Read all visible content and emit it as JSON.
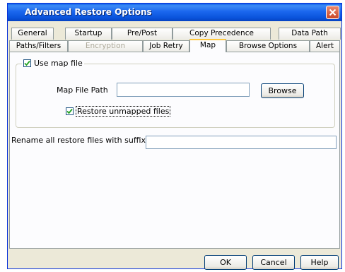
{
  "window": {
    "title": "Advanced Restore Options"
  },
  "tabs_row1": [
    {
      "label": "General"
    },
    {
      "label": "Startup"
    },
    {
      "label": "Pre/Post"
    },
    {
      "label": "Copy Precedence"
    },
    {
      "label": "Data Path"
    }
  ],
  "tabs_row2": [
    {
      "label": "Paths/Filters"
    },
    {
      "label": "Encryption"
    },
    {
      "label": "Job Retry"
    },
    {
      "label": "Map"
    },
    {
      "label": "Browse Options"
    },
    {
      "label": "Alert"
    }
  ],
  "map": {
    "use_map_file_label": "Use map file",
    "use_map_file_checked": true,
    "map_file_path_label": "Map File Path",
    "map_file_path_value": "",
    "browse_label": "Browse",
    "restore_unmapped_label": "Restore unmapped files",
    "restore_unmapped_checked": true,
    "rename_suffix_label": "Rename all restore files with suffix",
    "rename_suffix_value": ""
  },
  "buttons": {
    "ok": "OK",
    "cancel": "Cancel",
    "help": "Help"
  },
  "colors": {
    "titlebar": "#0a54dc",
    "tab_active_highlight": "#ffc83c",
    "close_button": "#c94829",
    "checkmark": "#21a121"
  }
}
